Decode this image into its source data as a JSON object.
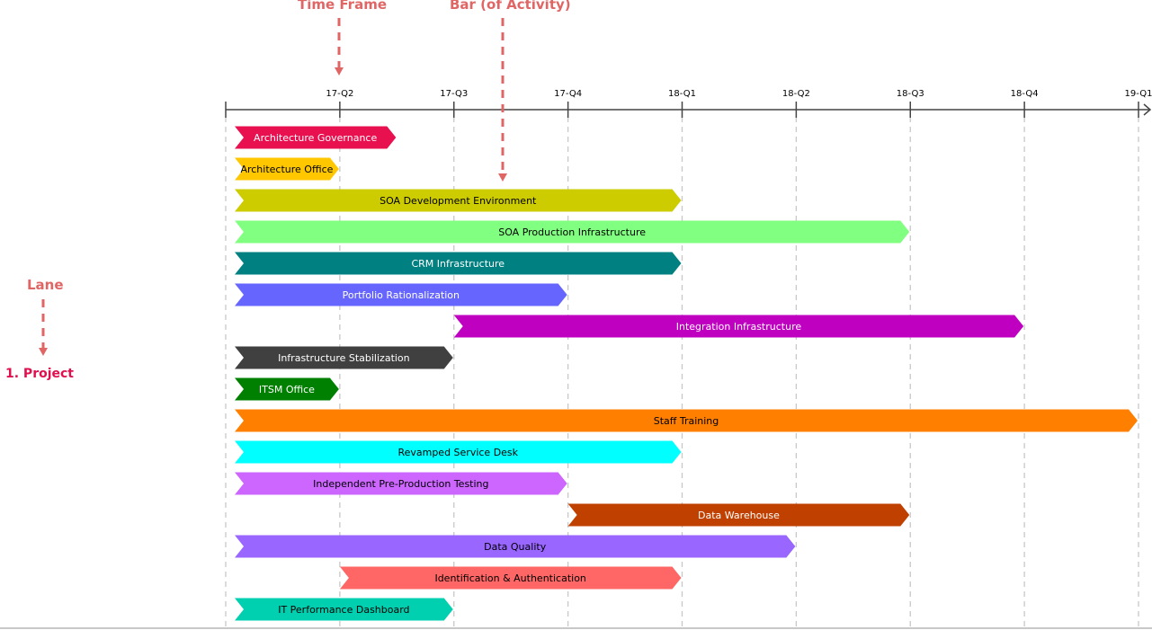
{
  "callouts": {
    "time_frame": "Time Frame",
    "bar_of_activity": "Bar (of Activity)",
    "lane": "Lane"
  },
  "lane": {
    "label": "1. Project"
  },
  "colors": {
    "callout": "#e06666",
    "lane_label": "#e0104f",
    "axis": "#444444",
    "gridline": "#c8c8c8"
  },
  "chart_data": {
    "type": "gantt",
    "title": "",
    "time_unit": "quarter",
    "axis_start": "17-Q1",
    "ticks": [
      "17-Q2",
      "17-Q3",
      "17-Q4",
      "18-Q1",
      "18-Q2",
      "18-Q3",
      "18-Q4",
      "19-Q1"
    ],
    "xlim_quarters": [
      0,
      8
    ],
    "grid": true,
    "tasks": [
      {
        "name": "Architecture Governance",
        "start": 0,
        "end": 1.5,
        "color": "#e8104f",
        "text_color": "#ffffff"
      },
      {
        "name": "Architecture Office",
        "start": 0,
        "end": 1,
        "color": "#ffc700",
        "text_color": "#000000"
      },
      {
        "name": "SOA Development Environment",
        "start": 0,
        "end": 4,
        "color": "#cccc00",
        "text_color": "#000000"
      },
      {
        "name": "SOA Production Infrastructure",
        "start": 0,
        "end": 6,
        "color": "#80ff80",
        "text_color": "#000000"
      },
      {
        "name": "CRM Infrastructure",
        "start": 0,
        "end": 4,
        "color": "#008080",
        "text_color": "#ffffff"
      },
      {
        "name": "Portfolio Rationalization",
        "start": 0,
        "end": 3,
        "color": "#6666ff",
        "text_color": "#ffffff"
      },
      {
        "name": "Integration Infrastructure",
        "start": 2,
        "end": 7,
        "color": "#c000c0",
        "text_color": "#ffffff"
      },
      {
        "name": "Infrastructure Stabilization",
        "start": 0,
        "end": 2,
        "color": "#404040",
        "text_color": "#ffffff"
      },
      {
        "name": "ITSM Office",
        "start": 0,
        "end": 1,
        "color": "#008000",
        "text_color": "#ffffff"
      },
      {
        "name": "Staff Training",
        "start": 0,
        "end": 8,
        "color": "#ff8000",
        "text_color": "#000000"
      },
      {
        "name": "Revamped Service Desk",
        "start": 0,
        "end": 4,
        "color": "#00ffff",
        "text_color": "#000000"
      },
      {
        "name": "Independent Pre-Production Testing",
        "start": 0,
        "end": 3,
        "color": "#cc66ff",
        "text_color": "#000000"
      },
      {
        "name": "Data Warehouse",
        "start": 3,
        "end": 6,
        "color": "#c04000",
        "text_color": "#ffffff"
      },
      {
        "name": "Data Quality",
        "start": 0,
        "end": 5,
        "color": "#9966ff",
        "text_color": "#000000"
      },
      {
        "name": "Identification & Authentication",
        "start": 1,
        "end": 4,
        "color": "#ff6666",
        "text_color": "#000000"
      },
      {
        "name": "IT Performance Dashboard",
        "start": 0,
        "end": 2,
        "color": "#00d0b0",
        "text_color": "#000000"
      }
    ]
  }
}
